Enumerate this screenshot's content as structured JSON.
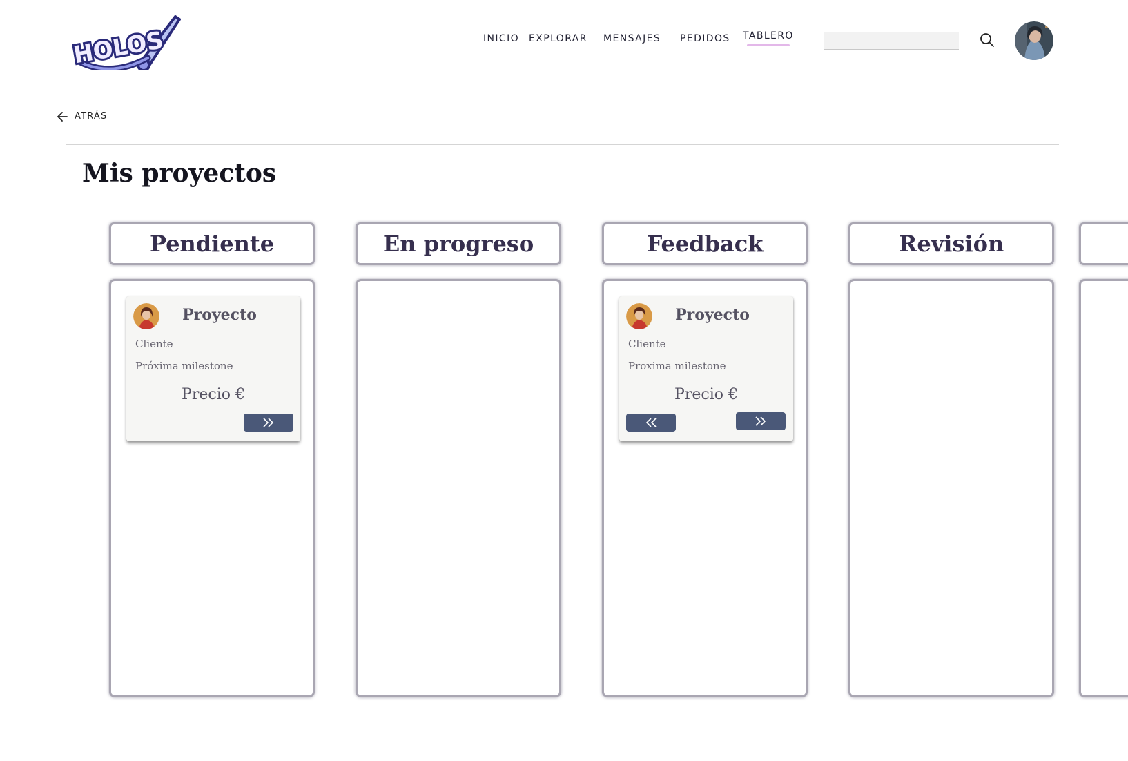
{
  "header": {
    "logo_text": "HOLOS",
    "nav": [
      {
        "label": "INICIO",
        "active": false
      },
      {
        "label": "EXPLORAR",
        "active": false
      },
      {
        "label": "MENSAJES",
        "active": false
      },
      {
        "label": "PEDIDOS",
        "active": false
      },
      {
        "label": "TABLERO",
        "active": true
      }
    ],
    "search": {
      "value": "",
      "placeholder": ""
    },
    "search_icon": "search-icon",
    "avatar_icon": "user-avatar"
  },
  "back": {
    "label": "ATRÁS",
    "icon": "arrow-left-icon"
  },
  "page_title": "Mis proyectos",
  "columns": [
    {
      "title": "Pendiente",
      "cards": [
        {
          "title": "Proyecto",
          "client": "Cliente",
          "milestone": "Próxima milestone",
          "price": "Precio €",
          "prev": false,
          "next": true
        }
      ]
    },
    {
      "title": "En progreso",
      "cards": []
    },
    {
      "title": "Feedback",
      "cards": [
        {
          "title": "Proyecto",
          "client": "Cliente",
          "milestone": "Proxima milestone",
          "price": "Precio €",
          "prev": true,
          "next": true
        }
      ]
    },
    {
      "title": "Revisión",
      "cards": []
    },
    {
      "title": "",
      "cards": []
    }
  ],
  "colors": {
    "accent_underline": "#e3b8e9",
    "button": "#4a5878",
    "column_title": "#362f4e",
    "logo_fill": "#6b63d4",
    "logo_outline": "#2a2a7a"
  }
}
